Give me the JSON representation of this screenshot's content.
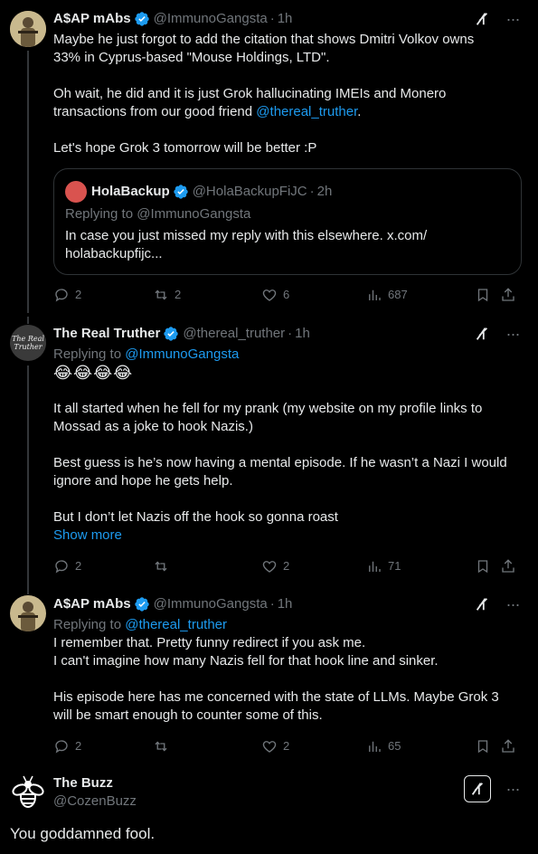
{
  "tweets": [
    {
      "name": "A$AP mAbs",
      "handle": "@ImmunoGangsta",
      "time": "1h",
      "text": "Maybe he just forgot to add the citation that shows Dmitri Volkov owns\n33% in Cyprus-based \"Mouse Holdings, LTD\".\n\nOh wait, he did and it is just Grok hallucinating IMEIs and Monero\ntransactions from our good friend ",
      "mention": "@thereal_truther",
      "text_after": ".\n\nLet's hope Grok 3 tomorrow will be better :P",
      "quote": {
        "name": "HolaBackup",
        "handle": "@HolaBackupFiJC",
        "time": "2h",
        "replying_to": "Replying to @ImmunoGangsta",
        "text": "In case you just missed my reply with this elsewhere. x.com/\nholabackupfijc..."
      },
      "replies": "2",
      "reposts": "2",
      "likes": "6",
      "views": "687"
    },
    {
      "name": "The Real Truther",
      "handle": "@thereal_truther",
      "time": "1h",
      "replying_label": "Replying to ",
      "replying_handle": "@ImmunoGangsta",
      "emojis": "😂😂😂😂",
      "text": "It all started when he fell for my prank (my website on my profile links to\nMossad as a joke to hook Nazis.)\n\nBest guess is he’s now having a mental episode. If he wasn’t a Nazi I would\nignore and hope he gets help.\n\nBut I don’t let Nazis off the hook so gonna roast",
      "show_more": "Show more",
      "avatar_text": "The Real Truther",
      "replies": "2",
      "reposts": "",
      "likes": "2",
      "views": "71"
    },
    {
      "name": "A$AP mAbs",
      "handle": "@ImmunoGangsta",
      "time": "1h",
      "replying_label": "Replying to ",
      "replying_handle": "@thereal_truther",
      "text": "I remember that. Pretty funny redirect if you ask me.\nI can't imagine how many Nazis fell for that hook line and sinker.\n\nHis episode here has me concerned with the state of LLMs. Maybe Grok 3\nwill be smart enough to counter some of this.",
      "replies": "2",
      "reposts": "",
      "likes": "2",
      "views": "65"
    },
    {
      "name": "The Buzz",
      "handle": "@CozenBuzz",
      "text": "You goddamned fool."
    }
  ],
  "colors": {
    "background": "#000000",
    "text": "#e7e9ea",
    "muted": "#71767b",
    "accent": "#1d9bf0"
  },
  "icons": [
    "verified-badge-icon",
    "grok-icon",
    "more-icon",
    "reply-icon",
    "repost-icon",
    "like-icon",
    "views-icon",
    "bookmark-icon",
    "share-icon"
  ]
}
